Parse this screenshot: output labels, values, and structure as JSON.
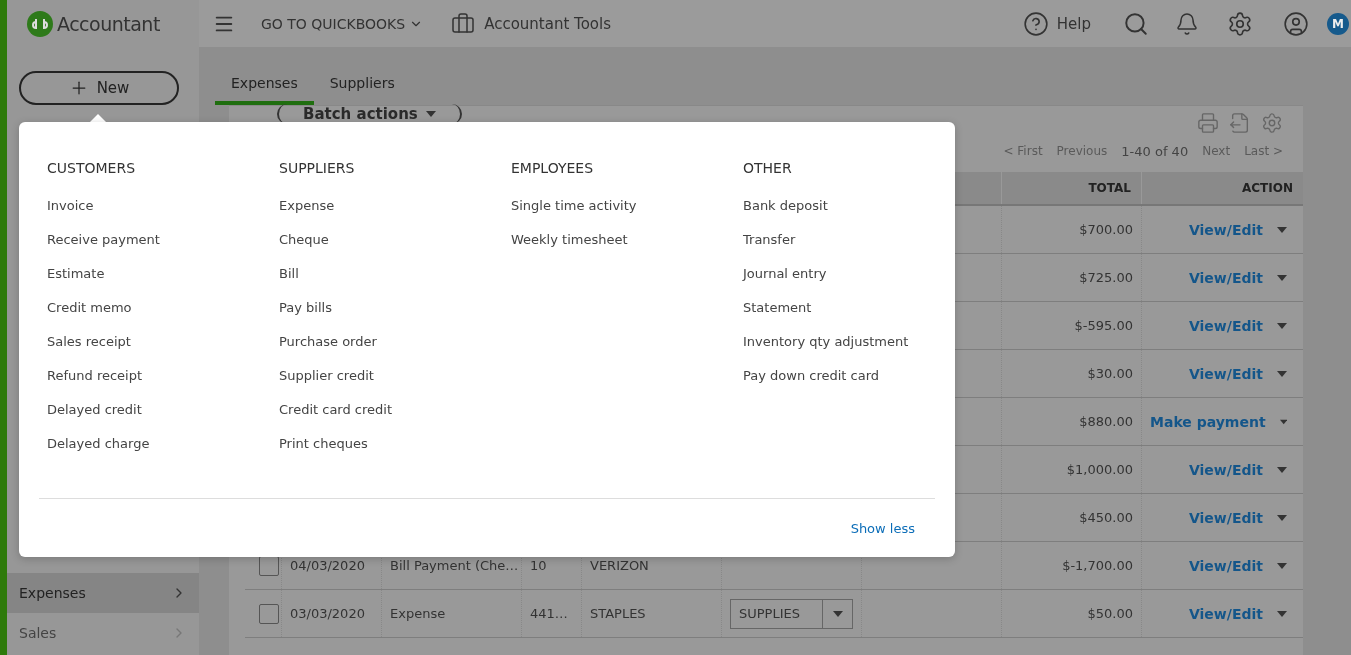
{
  "brand": {
    "name": "Accountant"
  },
  "topbar": {
    "menu": "GO TO QUICKBOOKS",
    "tools": "Accountant Tools",
    "help": "Help",
    "avatar": "M"
  },
  "new_button": {
    "label": "New"
  },
  "sidebar": {
    "items": [
      {
        "label": "Expenses",
        "selected": true
      },
      {
        "label": "Sales",
        "selected": false
      }
    ]
  },
  "tabs": [
    {
      "label": "Expenses",
      "selected": true
    },
    {
      "label": "Suppliers",
      "selected": false
    }
  ],
  "batch_actions": "Batch actions",
  "pagination": {
    "first": "< First",
    "previous": "Previous",
    "range": "1-40 of 40",
    "next": "Next",
    "last": "Last >"
  },
  "table": {
    "header": {
      "total": "TOTAL",
      "action": "ACTION"
    },
    "rows": [
      {
        "total": "$700.00",
        "action": "View/Edit"
      },
      {
        "total": "$725.00",
        "action": "View/Edit"
      },
      {
        "total": "$-595.00",
        "action": "View/Edit"
      },
      {
        "total": "$30.00",
        "action": "View/Edit"
      },
      {
        "total": "$880.00",
        "action": "Make payment"
      },
      {
        "total": "$1,000.00",
        "action": "View/Edit"
      },
      {
        "total": "$450.00",
        "action": "View/Edit"
      },
      {
        "checked": false,
        "date": "04/03/2020",
        "type": "Bill Payment (Che…",
        "no": "10",
        "payee": "VERIZON",
        "total": "$-1,700.00",
        "action": "View/Edit"
      },
      {
        "checked": false,
        "date": "03/03/2020",
        "type": "Expense",
        "no": "441…",
        "payee": "STAPLES",
        "category": "SUPPLIES",
        "total": "$50.00",
        "action": "View/Edit"
      }
    ]
  },
  "new_menu": {
    "sections": [
      {
        "heading": "CUSTOMERS",
        "items": [
          "Invoice",
          "Receive payment",
          "Estimate",
          "Credit memo",
          "Sales receipt",
          "Refund receipt",
          "Delayed credit",
          "Delayed charge"
        ]
      },
      {
        "heading": "SUPPLIERS",
        "items": [
          "Expense",
          "Cheque",
          "Bill",
          "Pay bills",
          "Purchase order",
          "Supplier credit",
          "Credit card credit",
          "Print cheques"
        ]
      },
      {
        "heading": "EMPLOYEES",
        "items": [
          "Single time activity",
          "Weekly timesheet"
        ]
      },
      {
        "heading": "OTHER",
        "items": [
          "Bank deposit",
          "Transfer",
          "Journal entry",
          "Statement",
          "Inventory qty adjustment",
          "Pay down credit card"
        ]
      }
    ],
    "show_less": "Show less"
  }
}
